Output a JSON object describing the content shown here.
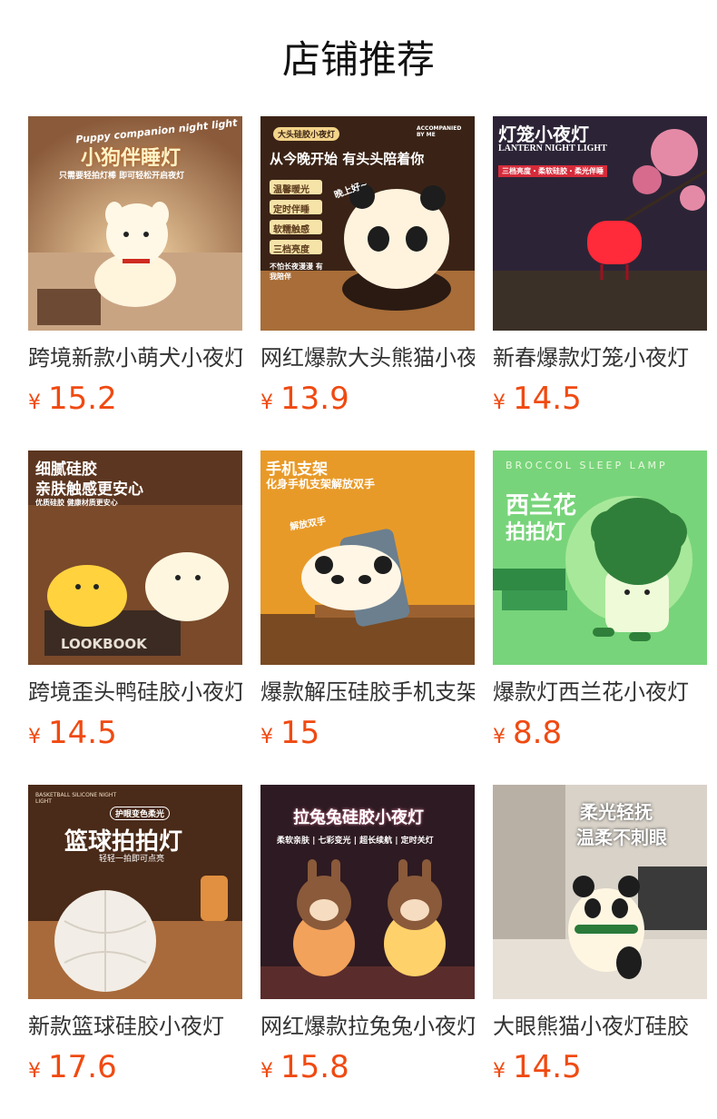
{
  "page": {
    "title": "店铺推荐"
  },
  "products": [
    {
      "name": "跨境新款小萌犬小夜灯",
      "price": "15.2",
      "currency": "¥",
      "image_text": {
        "top": "Puppy companion night light",
        "headline": "小狗伴睡灯",
        "sub": "只需要轻拍灯棒 即可轻松开启夜灯"
      }
    },
    {
      "name": "网红爆款大头熊猫小夜灯",
      "price": "13.9",
      "currency": "¥",
      "image_text": {
        "badge": "大头硅胶小夜灯",
        "corner": "ACCOMPANIED BY ME",
        "headline": "从今晚开始 有头头陪着你",
        "tags": [
          "温馨暖光",
          "定时伴睡",
          "软糯触感",
          "三档亮度"
        ],
        "sub": "不怕长夜漫漫 有我陪伴",
        "bubble": "晚上好~"
      }
    },
    {
      "name": "新春爆款灯笼小夜灯",
      "price": "14.5",
      "currency": "¥",
      "image_text": {
        "headline": "灯笼小夜灯",
        "en": "LANTERN NIGHT LIGHT",
        "sub": "三档亮度・柔软硅胶・柔光伴睡"
      }
    },
    {
      "name": "跨境歪头鸭硅胶小夜灯",
      "price": "14.5",
      "currency": "¥",
      "image_text": {
        "headline": "细腻硅胶",
        "headline2": "亲肤触感更安心",
        "sub": "优质硅胶 健康材质更安心",
        "book": "LOOKBOOK"
      }
    },
    {
      "name": "爆款解压硅胶手机支架小夜灯",
      "price": "15",
      "currency": "¥",
      "image_text": {
        "headline": "手机支架",
        "sub": "化身手机支架解放双手",
        "bubble": "解放双手"
      }
    },
    {
      "name": "爆款灯西兰花小夜灯",
      "price": "8.8",
      "currency": "¥",
      "image_text": {
        "top": "BROCCOL SLEEP LAMP",
        "headline": "西兰花",
        "headline2": "拍拍灯"
      }
    },
    {
      "name": "新款篮球硅胶小夜灯",
      "price": "17.6",
      "currency": "¥",
      "image_text": {
        "top": "BASKETBALL SILICONE NIGHT LIGHT",
        "badge": "护眼变色柔光",
        "headline": "篮球拍拍灯",
        "sub": "轻轻一拍即可点亮"
      }
    },
    {
      "name": "网红爆款拉兔兔小夜灯",
      "price": "15.8",
      "currency": "¥",
      "image_text": {
        "headline": "拉兔兔硅胶小夜灯",
        "sub": "柔软亲肤 | 七彩变光 | 超长续航 | 定时关灯"
      }
    },
    {
      "name": "大眼熊猫小夜灯硅胶",
      "price": "14.5",
      "currency": "¥",
      "image_text": {
        "headline": "柔光轻抚",
        "headline2": "温柔不刺眼"
      }
    }
  ],
  "colors": {
    "price": "#f04a12",
    "title": "#111111",
    "name": "#333333"
  }
}
